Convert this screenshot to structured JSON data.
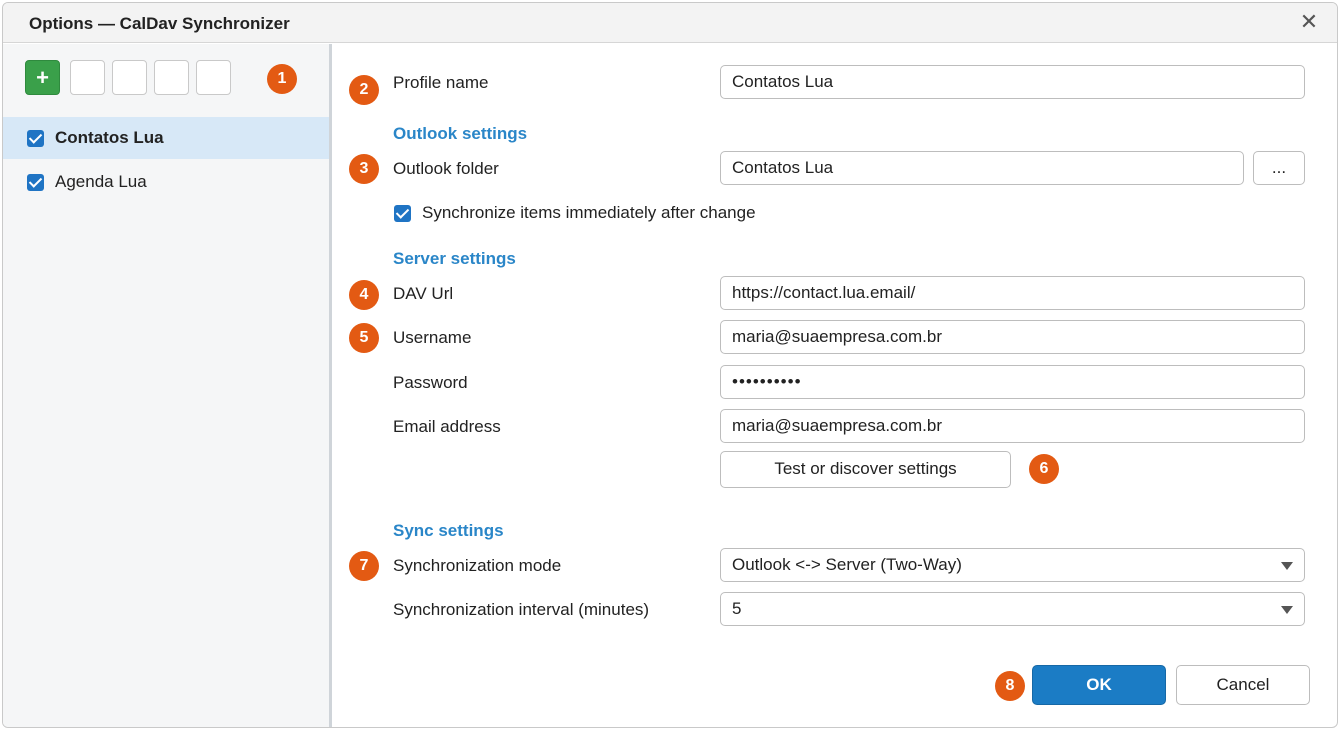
{
  "window": {
    "title": "Options — CalDav Synchronizer"
  },
  "toolbar": {
    "add_label": "+"
  },
  "badges": [
    "1",
    "2",
    "3",
    "4",
    "5",
    "6",
    "7",
    "8"
  ],
  "profiles": [
    {
      "name": "Contatos Lua",
      "checked": true,
      "selected": true
    },
    {
      "name": "Agenda Lua",
      "checked": true,
      "selected": false
    }
  ],
  "form": {
    "profile_name_label": "Profile name",
    "profile_name_value": "Contatos Lua",
    "outlook_section": "Outlook settings",
    "outlook_folder_label": "Outlook folder",
    "outlook_folder_value": "Contatos Lua",
    "browse_label": "...",
    "sync_immediately_label": "Synchronize items immediately after change",
    "server_section": "Server settings",
    "dav_url_label": "DAV Url",
    "dav_url_value": "https://contact.lua.email/",
    "username_label": "Username",
    "username_value": "maria@suaempresa.com.br",
    "password_label": "Password",
    "password_value": "••••••••••",
    "email_label": "Email address",
    "email_value": "maria@suaempresa.com.br",
    "test_button": "Test or discover settings",
    "sync_section": "Sync settings",
    "sync_mode_label": "Synchronization mode",
    "sync_mode_value": "Outlook <-> Server (Two-Way)",
    "sync_interval_label": "Synchronization interval (minutes)",
    "sync_interval_value": "5"
  },
  "footer": {
    "ok_label": "OK",
    "cancel_label": "Cancel"
  },
  "colors": {
    "accent": "#2a86c8",
    "badge": "#e35a13",
    "add_button": "#3aa04a",
    "primary_button": "#1b7cc5"
  }
}
